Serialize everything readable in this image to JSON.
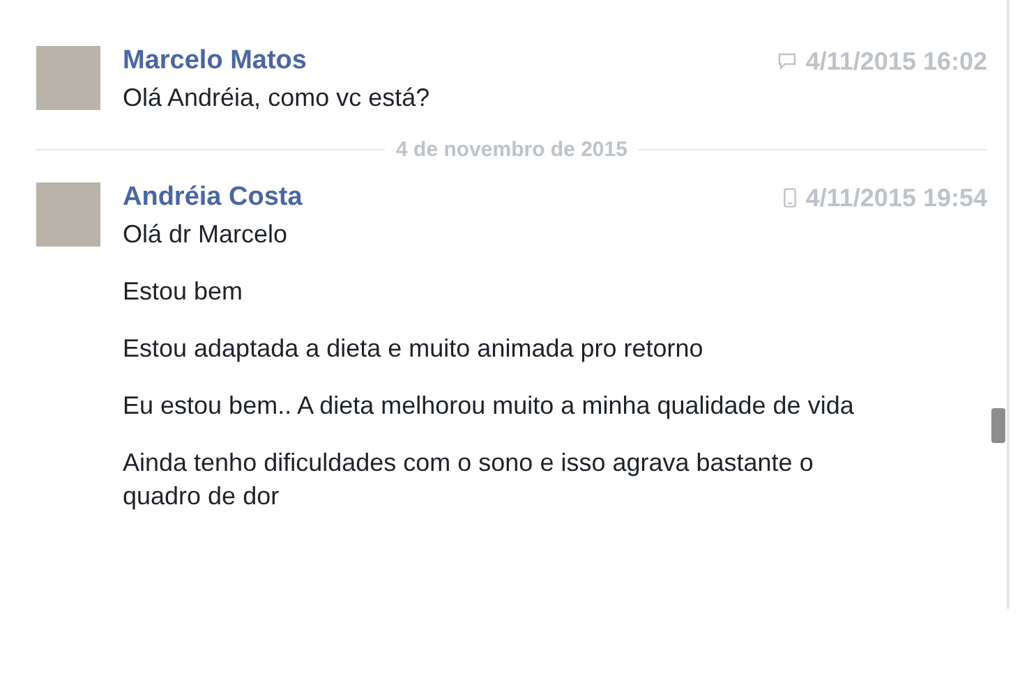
{
  "conversation": [
    {
      "kind": "messages",
      "sender": "Marcelo Matos",
      "mobile": false,
      "time": "4/11/2015 16:02",
      "messages": [
        "Olá Andréia, como vc está?"
      ]
    },
    {
      "kind": "date",
      "label": "4 de novembro de 2015"
    },
    {
      "kind": "messages",
      "sender": "Andréia Costa",
      "mobile": true,
      "time": "4/11/2015 19:54",
      "messages": [
        "Olá dr Marcelo",
        "Estou bem",
        "Estou adaptada a dieta e muito animada pro retorno",
        "Eu estou bem.. A dieta melhorou muito a minha qualidade de vida",
        "Ainda tenho dificuldades com o sono e isso agrava bastante o quadro de dor"
      ]
    }
  ]
}
